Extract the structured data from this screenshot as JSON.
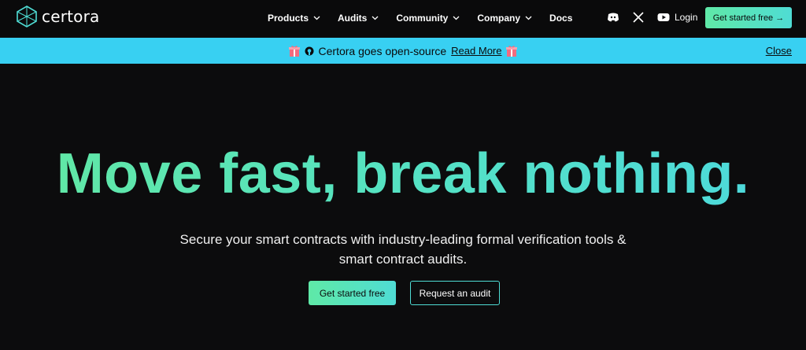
{
  "nav": {
    "logo_text": "certora",
    "menu": [
      {
        "label": "Products",
        "has_dropdown": true
      },
      {
        "label": "Audits",
        "has_dropdown": true
      },
      {
        "label": "Community",
        "has_dropdown": true
      },
      {
        "label": "Company",
        "has_dropdown": true
      },
      {
        "label": "Docs",
        "has_dropdown": false
      }
    ],
    "socials": [
      "discord-icon",
      "x-icon",
      "youtube-icon"
    ],
    "login_label": "Login",
    "cta_label": "Get started free →"
  },
  "banner": {
    "text": "Certora goes open-source",
    "link_label": "Read More",
    "close_label": "Close",
    "icons": [
      "gift-icon",
      "github-icon"
    ]
  },
  "hero": {
    "title": "Move fast, break nothing.",
    "subtitle": "Secure your smart contracts with industry-leading formal verification tools & smart contract audits.",
    "primary_button": "Get started free",
    "secondary_button": "Request an audit"
  },
  "colors": {
    "background": "#0c0c0d",
    "banner": "#38d0f2",
    "accent_green": "#5fe9a7",
    "accent_cyan": "#4fdcd4"
  }
}
